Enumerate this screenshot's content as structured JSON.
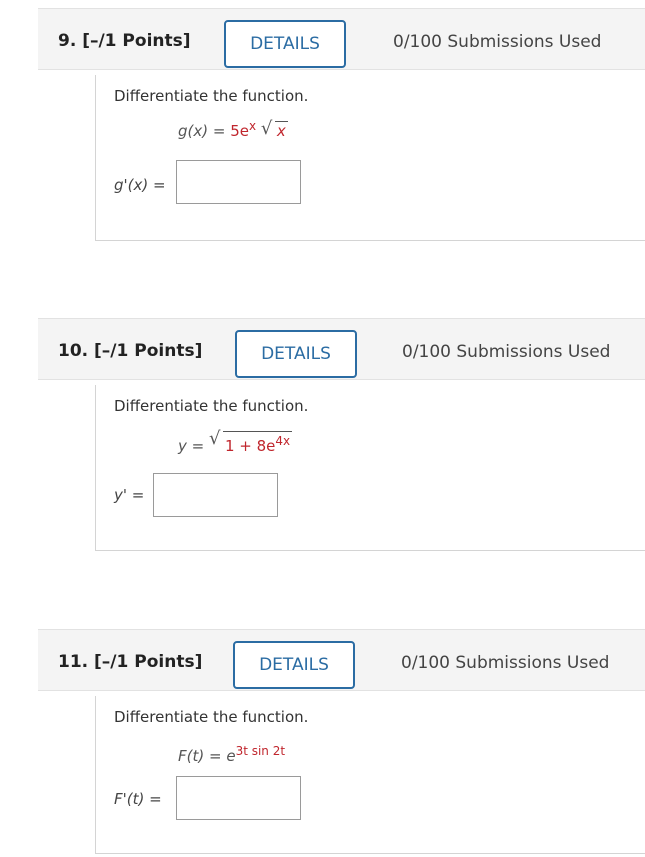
{
  "questions": [
    {
      "title": "9. [–/1 Points]",
      "details_label": "DETAILS",
      "submissions": "0/100 Submissions Used",
      "prompt": "Differentiate the function.",
      "formula_lhs": "g(x) = ",
      "formula_coef": "5e",
      "formula_exp": "x",
      "formula_radicand": "x",
      "answer_label": "g'(x) =",
      "answer_value": ""
    },
    {
      "title": "10. [–/1 Points]",
      "details_label": "DETAILS",
      "submissions": "0/100 Submissions Used",
      "prompt": "Differentiate the function.",
      "formula_lhs": "y = ",
      "formula_radicand": "1 + 8e",
      "formula_exp": "4x",
      "answer_label": "y' =",
      "answer_value": ""
    },
    {
      "title": "11. [–/1 Points]",
      "details_label": "DETAILS",
      "submissions": "0/100 Submissions Used",
      "prompt": "Differentiate the function.",
      "formula_lhs": "F(t) = ",
      "formula_base": "e",
      "formula_exp": "3t sin 2t",
      "answer_label": "F'(t) =",
      "answer_value": ""
    }
  ]
}
